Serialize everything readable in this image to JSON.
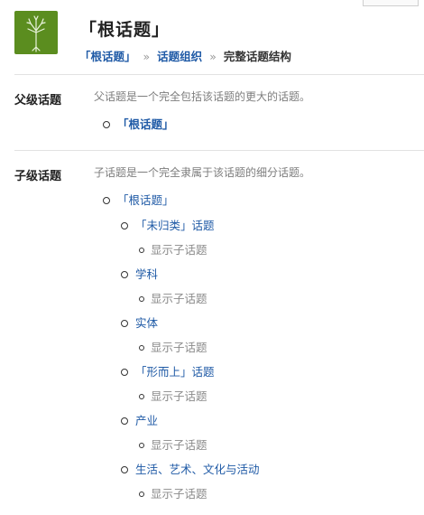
{
  "header": {
    "title": "「根话题」",
    "logo_icon": "tree-logo-icon",
    "breadcrumb": {
      "items": [
        "「根话题」",
        "话题组织",
        "完整话题结构"
      ],
      "separator": "»"
    }
  },
  "parent_section": {
    "label": "父级话题",
    "description": "父话题是一个完全包括该话题的更大的话题。",
    "items": [
      "「根话题」"
    ]
  },
  "child_section": {
    "label": "子级话题",
    "description": "子话题是一个完全隶属于该话题的细分话题。",
    "root": "「根话题」",
    "children": [
      {
        "label": "「未归类」话题",
        "sub": "显示子话题"
      },
      {
        "label": "学科",
        "sub": "显示子话题"
      },
      {
        "label": "实体",
        "sub": "显示子话题"
      },
      {
        "label": "「形而上」话题",
        "sub": "显示子话题"
      },
      {
        "label": "产业",
        "sub": "显示子话题"
      },
      {
        "label": "生活、艺术、文化与活动",
        "sub": "显示子话题"
      }
    ]
  },
  "colors": {
    "link": "#1f5aa6",
    "muted": "#8a8a8a",
    "logo_bg": "#5b8d1f"
  }
}
